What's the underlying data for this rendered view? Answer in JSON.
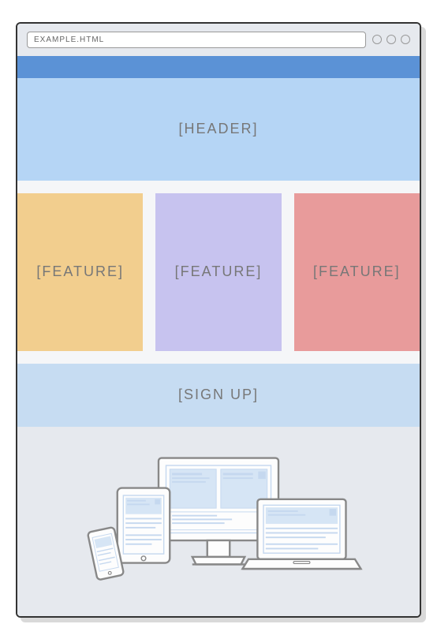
{
  "browser": {
    "url": "EXAMPLE.HTML"
  },
  "layout": {
    "header": "[HEADER]",
    "features": [
      {
        "label": "[FEATURE]"
      },
      {
        "label": "[FEATURE]"
      },
      {
        "label": "[FEATURE]"
      }
    ],
    "signup": "[SIGN UP]"
  },
  "colors": {
    "topbar": "#5b92d6",
    "header": "#b5d5f5",
    "feature1": "#f2ce8e",
    "feature2": "#c7c3ef",
    "feature3": "#e89b9b",
    "signup": "#c6dcf2"
  }
}
